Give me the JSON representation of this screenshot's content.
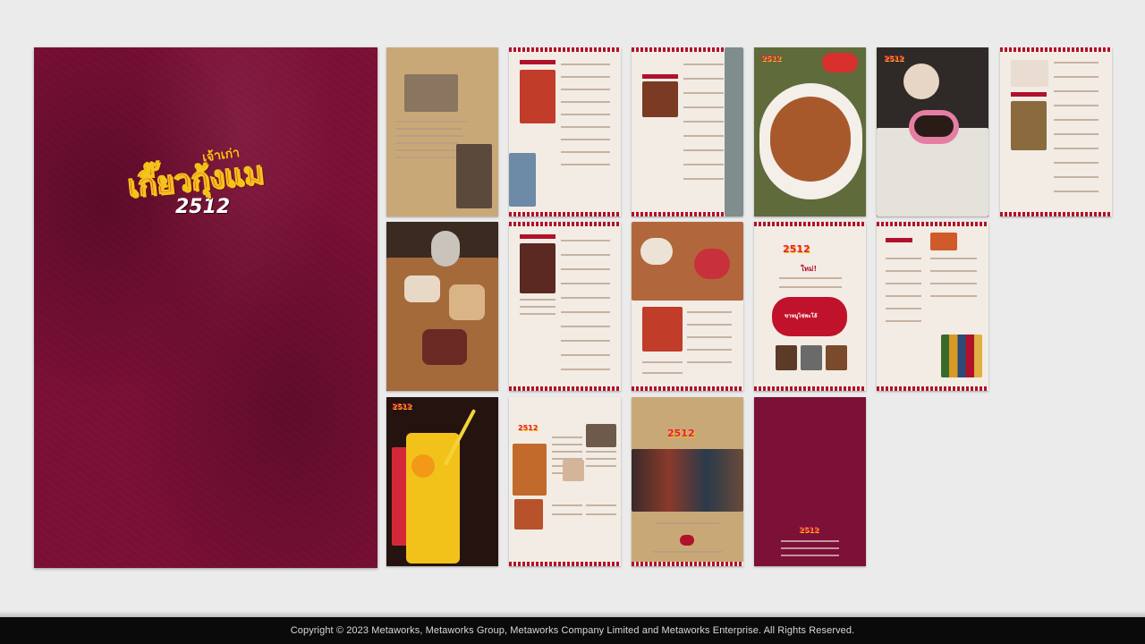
{
  "brand": {
    "logo_small": "เจ้าเก่า",
    "logo_main": "เกี๊ยวกุ้งแม",
    "logo_number": "2512",
    "colors": {
      "maroon": "#7c1037",
      "red": "#b0122b",
      "yellow": "#f3c41a",
      "paper": "#f2ece4",
      "kraft": "#c9a878"
    }
  },
  "pages": {
    "page_with_pig": {
      "headline": "ใหม่!",
      "banner": "ขาหมูไข่พะโล้"
    }
  },
  "footer": {
    "copyright": "Copyright © 2023 Metaworks, Metaworks Group, Metaworks Company Limited and Metaworks Enterprise. All Rights Reserved."
  }
}
